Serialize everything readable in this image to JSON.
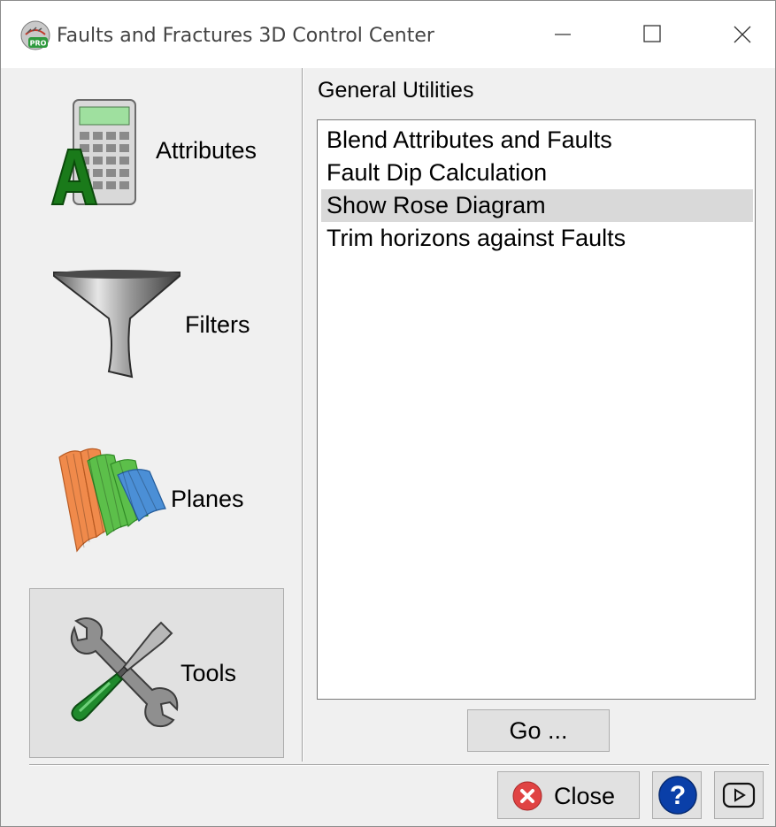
{
  "window": {
    "title": "Faults and Fractures 3D Control Center",
    "app_icon_badge": "PRO",
    "controls": [
      "minimize",
      "maximize",
      "close"
    ]
  },
  "sidebar": {
    "items": [
      {
        "label": "Attributes",
        "icon": "calculator-icon",
        "selected": false
      },
      {
        "label": "Filters",
        "icon": "funnel-icon",
        "selected": false
      },
      {
        "label": "Planes",
        "icon": "planes-icon",
        "selected": false
      },
      {
        "label": "Tools",
        "icon": "wrench-screwdriver-icon",
        "selected": true
      }
    ]
  },
  "main": {
    "section_title": "General Utilities",
    "list": {
      "items": [
        "Blend Attributes and Faults",
        "Fault Dip Calculation",
        "Show Rose Diagram",
        "Trim horizons against Faults"
      ],
      "selected_index": 2
    },
    "go_label": "Go ..."
  },
  "footer": {
    "close_label": "Close",
    "help_icon": "help-icon",
    "video_icon": "play-video-icon"
  },
  "colors": {
    "window_bg": "#f0f0f0",
    "selected_bg": "#e1e1e1",
    "list_selected_bg": "#d9d9d9",
    "close_red": "#e04343",
    "help_blue": "#0a3fa8"
  }
}
